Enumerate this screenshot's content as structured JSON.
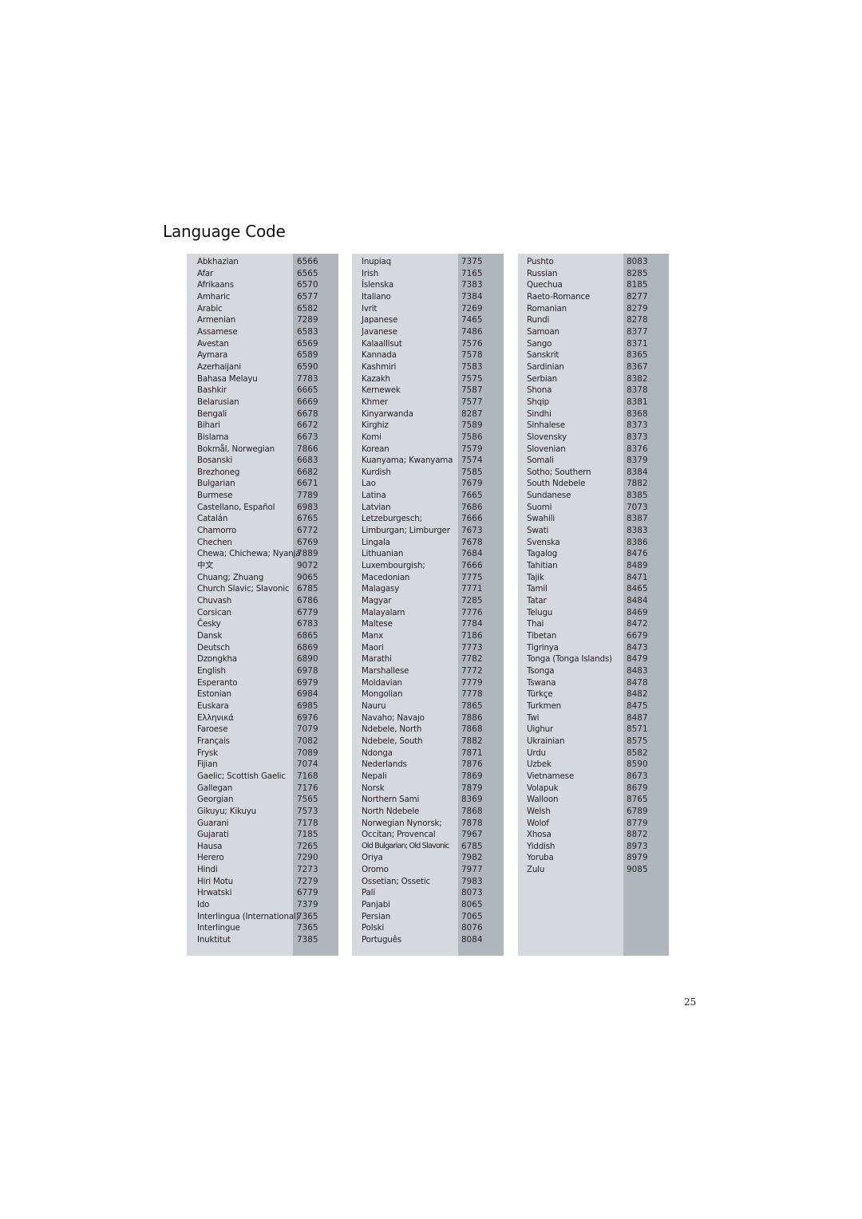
{
  "page": {
    "title": "Language Code",
    "page_number": "25"
  },
  "colors": {
    "panel_bg": "#d5d8dc",
    "code_column_bg": "#b1b5bc",
    "text": "#231f20"
  },
  "columns": [
    {
      "rows": [
        {
          "language": "Abkhazian",
          "code": "6566"
        },
        {
          "language": "Afar",
          "code": "6565"
        },
        {
          "language": "Afrikaans",
          "code": "6570"
        },
        {
          "language": "Amharic",
          "code": "6577"
        },
        {
          "language": "Arabic",
          "code": "6582"
        },
        {
          "language": "Armenian",
          "code": "7289"
        },
        {
          "language": "Assamese",
          "code": "6583"
        },
        {
          "language": "Avestan",
          "code": "6569"
        },
        {
          "language": "Aymara",
          "code": "6589"
        },
        {
          "language": "Azerhaijani",
          "code": "6590"
        },
        {
          "language": "Bahasa Melayu",
          "code": "7783"
        },
        {
          "language": "Bashkir",
          "code": "6665"
        },
        {
          "language": "Belarusian",
          "code": "6669"
        },
        {
          "language": "Bengali",
          "code": "6678"
        },
        {
          "language": "Bihari",
          "code": "6672"
        },
        {
          "language": "Bislama",
          "code": "6673"
        },
        {
          "language": "Bokmål, Norwegian",
          "code": "7866"
        },
        {
          "language": "Bosanski",
          "code": "6683"
        },
        {
          "language": "Brezhoneg",
          "code": "6682"
        },
        {
          "language": "Bulgarian",
          "code": "6671"
        },
        {
          "language": "Burmese",
          "code": "7789"
        },
        {
          "language": "Castellano, Español",
          "code": "6983"
        },
        {
          "language": "Catalán",
          "code": "6765"
        },
        {
          "language": "Chamorro",
          "code": "6772"
        },
        {
          "language": "Chechen",
          "code": "6769"
        },
        {
          "language": "Chewa; Chichewa; Nyanja",
          "code": "7889"
        },
        {
          "language": "中文",
          "code": "9072"
        },
        {
          "language": "Chuang; Zhuang",
          "code": "9065"
        },
        {
          "language": "Church Slavic; Slavonic",
          "code": "6785"
        },
        {
          "language": "Chuvash",
          "code": "6786"
        },
        {
          "language": "Corsican",
          "code": "6779"
        },
        {
          "language": "Česky",
          "code": "6783"
        },
        {
          "language": "Dansk",
          "code": "6865"
        },
        {
          "language": "Deutsch",
          "code": "6869"
        },
        {
          "language": "Dzongkha",
          "code": "6890"
        },
        {
          "language": "English",
          "code": "6978"
        },
        {
          "language": "Esperanto",
          "code": "6979"
        },
        {
          "language": "Estonian",
          "code": "6984"
        },
        {
          "language": "Euskara",
          "code": "6985"
        },
        {
          "language": "Ελληνικά",
          "code": "6976"
        },
        {
          "language": "Faroese",
          "code": "7079"
        },
        {
          "language": "Français",
          "code": "7082"
        },
        {
          "language": "Frysk",
          "code": "7089"
        },
        {
          "language": "Fijian",
          "code": "7074"
        },
        {
          "language": "Gaelic; Scottish Gaelic",
          "code": "7168"
        },
        {
          "language": "Gallegan",
          "code": "7176"
        },
        {
          "language": "Georgian",
          "code": "7565"
        },
        {
          "language": "Gikuyu; Kikuyu",
          "code": "7573"
        },
        {
          "language": "Guarani",
          "code": "7178"
        },
        {
          "language": "Gujarati",
          "code": "7185"
        },
        {
          "language": "Hausa",
          "code": "7265"
        },
        {
          "language": "Herero",
          "code": "7290"
        },
        {
          "language": "Hindi",
          "code": "7273"
        },
        {
          "language": "Hiri Motu",
          "code": "7279"
        },
        {
          "language": "Hrwatski",
          "code": "6779"
        },
        {
          "language": "Ido",
          "code": "7379"
        },
        {
          "language": "Interlingua (International)",
          "code": "7365"
        },
        {
          "language": "Interlingue",
          "code": "7365"
        },
        {
          "language": "Inuktitut",
          "code": "7385"
        }
      ]
    },
    {
      "rows": [
        {
          "language": "Inupiaq",
          "code": "7375"
        },
        {
          "language": "Irish",
          "code": "7165"
        },
        {
          "language": "Íslenska",
          "code": "7383"
        },
        {
          "language": "Italiano",
          "code": "7384"
        },
        {
          "language": "Ivrit",
          "code": "7269"
        },
        {
          "language": "Japanese",
          "code": "7465"
        },
        {
          "language": "Javanese",
          "code": "7486"
        },
        {
          "language": "Kalaallisut",
          "code": "7576"
        },
        {
          "language": "Kannada",
          "code": "7578"
        },
        {
          "language": "Kashmiri",
          "code": "7583"
        },
        {
          "language": "Kazakh",
          "code": "7575"
        },
        {
          "language": "Kernewek",
          "code": "7587"
        },
        {
          "language": "Khmer",
          "code": "7577"
        },
        {
          "language": "Kinyarwanda",
          "code": "8287"
        },
        {
          "language": "Kirghiz",
          "code": "7589"
        },
        {
          "language": "Komi",
          "code": "7586"
        },
        {
          "language": "Korean",
          "code": "7579"
        },
        {
          "language": "Kuanyama; Kwanyama",
          "code": "7574"
        },
        {
          "language": "Kurdish",
          "code": "7585"
        },
        {
          "language": "Lao",
          "code": "7679"
        },
        {
          "language": "Latina",
          "code": "7665"
        },
        {
          "language": "Latvian",
          "code": "7686"
        },
        {
          "language": "Letzeburgesch;",
          "code": "7666"
        },
        {
          "language": "Limburgan; Limburger",
          "code": "7673"
        },
        {
          "language": "Lingala",
          "code": "7678"
        },
        {
          "language": "Lithuanian",
          "code": "7684"
        },
        {
          "language": "Luxembourgish;",
          "code": "7666"
        },
        {
          "language": "Macedonian",
          "code": "7775"
        },
        {
          "language": "Malagasy",
          "code": "7771"
        },
        {
          "language": "Magyar",
          "code": "7285"
        },
        {
          "language": "Malayalam",
          "code": "7776"
        },
        {
          "language": "Maltese",
          "code": "7784"
        },
        {
          "language": "Manx",
          "code": "7186"
        },
        {
          "language": "Maori",
          "code": "7773"
        },
        {
          "language": "Marathi",
          "code": "7782"
        },
        {
          "language": "Marshallese",
          "code": "7772"
        },
        {
          "language": "Moldavian",
          "code": "7779"
        },
        {
          "language": "Mongolian",
          "code": "7778"
        },
        {
          "language": "Nauru",
          "code": "7865"
        },
        {
          "language": "Navaho; Navajo",
          "code": "7886"
        },
        {
          "language": "Ndebele, North",
          "code": "7868"
        },
        {
          "language": "Ndebele, South",
          "code": "7882"
        },
        {
          "language": "Ndonga",
          "code": "7871"
        },
        {
          "language": "Nederlands",
          "code": "7876"
        },
        {
          "language": "Nepali",
          "code": "7869"
        },
        {
          "language": "Norsk",
          "code": "7879"
        },
        {
          "language": "Northern Sami",
          "code": "8369"
        },
        {
          "language": "North Ndebele",
          "code": "7868"
        },
        {
          "language": "Norwegian Nynorsk;",
          "code": "7878"
        },
        {
          "language": "Occitan; Provencal",
          "code": "7967"
        },
        {
          "language": "Old Bulgarian; Old Slavonic",
          "code": "6785",
          "condensed": true
        },
        {
          "language": "Oriya",
          "code": "7982"
        },
        {
          "language": "Oromo",
          "code": "7977"
        },
        {
          "language": "Ossetian; Ossetic",
          "code": "7983"
        },
        {
          "language": "Pali",
          "code": "8073"
        },
        {
          "language": "Panjabi",
          "code": "8065"
        },
        {
          "language": "Persian",
          "code": "7065"
        },
        {
          "language": "Polski",
          "code": "8076"
        },
        {
          "language": "Português",
          "code": "8084"
        }
      ]
    },
    {
      "rows": [
        {
          "language": "Pushto",
          "code": "8083"
        },
        {
          "language": "Russian",
          "code": "8285"
        },
        {
          "language": "Quechua",
          "code": "8185"
        },
        {
          "language": "Raeto-Romance",
          "code": "8277"
        },
        {
          "language": "Romanian",
          "code": "8279"
        },
        {
          "language": "Rundi",
          "code": "8278"
        },
        {
          "language": "Samoan",
          "code": "8377"
        },
        {
          "language": "Sango",
          "code": "8371"
        },
        {
          "language": "Sanskrit",
          "code": "8365"
        },
        {
          "language": "Sardinian",
          "code": "8367"
        },
        {
          "language": "Serbian",
          "code": "8382"
        },
        {
          "language": "Shona",
          "code": "8378"
        },
        {
          "language": "Shqip",
          "code": "8381"
        },
        {
          "language": "Sindhi",
          "code": "8368"
        },
        {
          "language": "Sinhalese",
          "code": "8373"
        },
        {
          "language": "Slovensky",
          "code": "8373"
        },
        {
          "language": "Slovenian",
          "code": "8376"
        },
        {
          "language": "Somali",
          "code": "8379"
        },
        {
          "language": "Sotho; Southern",
          "code": "8384"
        },
        {
          "language": "South Ndebele",
          "code": "7882"
        },
        {
          "language": "Sundanese",
          "code": "8385"
        },
        {
          "language": "Suomi",
          "code": "7073"
        },
        {
          "language": "Swahili",
          "code": "8387"
        },
        {
          "language": "Swati",
          "code": "8383"
        },
        {
          "language": "Svenska",
          "code": "8386"
        },
        {
          "language": "Tagalog",
          "code": "8476"
        },
        {
          "language": "Tahitian",
          "code": "8489"
        },
        {
          "language": "Tajik",
          "code": "8471"
        },
        {
          "language": "Tamil",
          "code": "8465"
        },
        {
          "language": "Tatar",
          "code": "8484"
        },
        {
          "language": "Telugu",
          "code": "8469"
        },
        {
          "language": "Thai",
          "code": "8472"
        },
        {
          "language": "Tibetan",
          "code": "6679"
        },
        {
          "language": "Tigrinya",
          "code": "8473"
        },
        {
          "language": "Tonga (Tonga Islands)",
          "code": "8479"
        },
        {
          "language": "Tsonga",
          "code": "8483"
        },
        {
          "language": "Tswana",
          "code": "8478"
        },
        {
          "language": "Türkçe",
          "code": "8482"
        },
        {
          "language": "Turkmen",
          "code": "8475"
        },
        {
          "language": "Twi",
          "code": "8487"
        },
        {
          "language": "Uighur",
          "code": "8571"
        },
        {
          "language": "Ukrainian",
          "code": "8575"
        },
        {
          "language": "Urdu",
          "code": "8582"
        },
        {
          "language": "Uzbek",
          "code": "8590"
        },
        {
          "language": "Vietnamese",
          "code": "8673"
        },
        {
          "language": "Volapuk",
          "code": "8679"
        },
        {
          "language": "Walloon",
          "code": "8765"
        },
        {
          "language": "Welsh",
          "code": "6789"
        },
        {
          "language": "Wolof",
          "code": "8779"
        },
        {
          "language": "Xhosa",
          "code": "8872"
        },
        {
          "language": "Yiddish",
          "code": "8973"
        },
        {
          "language": "Yoruba",
          "code": "8979"
        },
        {
          "language": "Zulu",
          "code": "9085"
        }
      ]
    }
  ]
}
